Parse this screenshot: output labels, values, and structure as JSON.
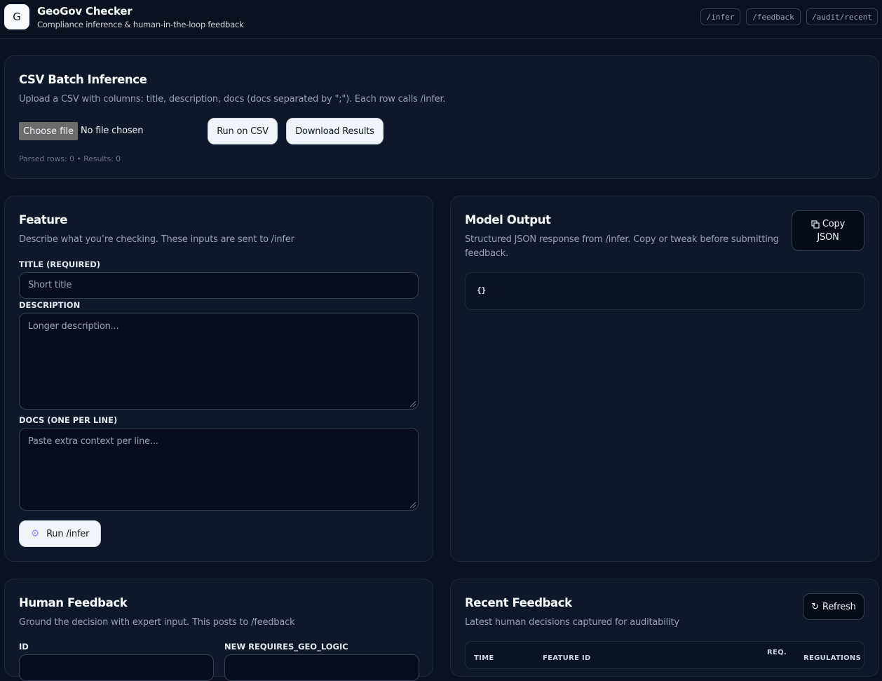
{
  "header": {
    "logo_letter": "G",
    "title": "GeoGov Checker",
    "subtitle": "Compliance inference & human-in-the-loop feedback",
    "endpoints": [
      "/infer",
      "/feedback",
      "/audit/recent"
    ]
  },
  "csv": {
    "title": "CSV Batch Inference",
    "description": "Upload a CSV with columns: title, description, docs (docs separated by \";\"). Each row calls /infer.",
    "choose_file_label": "Choose file",
    "no_file_label": "No file chosen",
    "run_label": "Run on CSV",
    "download_label": "Download Results",
    "status": "Parsed rows: 0 • Results: 0"
  },
  "feature": {
    "title": "Feature",
    "description": "Describe what you’re checking. These inputs are sent to /infer",
    "title_label": "TITLE (REQUIRED)",
    "title_placeholder": "Short title",
    "description_label": "DESCRIPTION",
    "description_placeholder": "Longer description...",
    "docs_label": "DOCS (ONE PER LINE)",
    "docs_placeholder": "Paste extra context per line...",
    "run_label": "Run /infer",
    "run_icon": "gear-icon"
  },
  "output": {
    "title": "Model Output",
    "description": "Structured JSON response from /infer. Copy or tweak before submitting feedback.",
    "copy_line1": "Copy",
    "copy_line2": "JSON",
    "copy_icon": "copy-icon",
    "json": "{}"
  },
  "human_feedback": {
    "title": "Human Feedback",
    "description": "Ground the decision with expert input. This posts to /feedback",
    "id_label": "ID",
    "geo_label": "NEW REQUIRES_GEO_LOGIC"
  },
  "recent": {
    "title": "Recent Feedback",
    "description": "Latest human decisions captured for auditability",
    "refresh_label": "Refresh",
    "refresh_icon": "refresh-icon",
    "columns": [
      "TIME",
      "FEATURE ID",
      "REQ.",
      "REGULATIONS"
    ]
  },
  "colors": {
    "background": "#0b1120",
    "card": "#0f172a",
    "border": "#1e293b",
    "light_button": "#f1f5f9"
  }
}
